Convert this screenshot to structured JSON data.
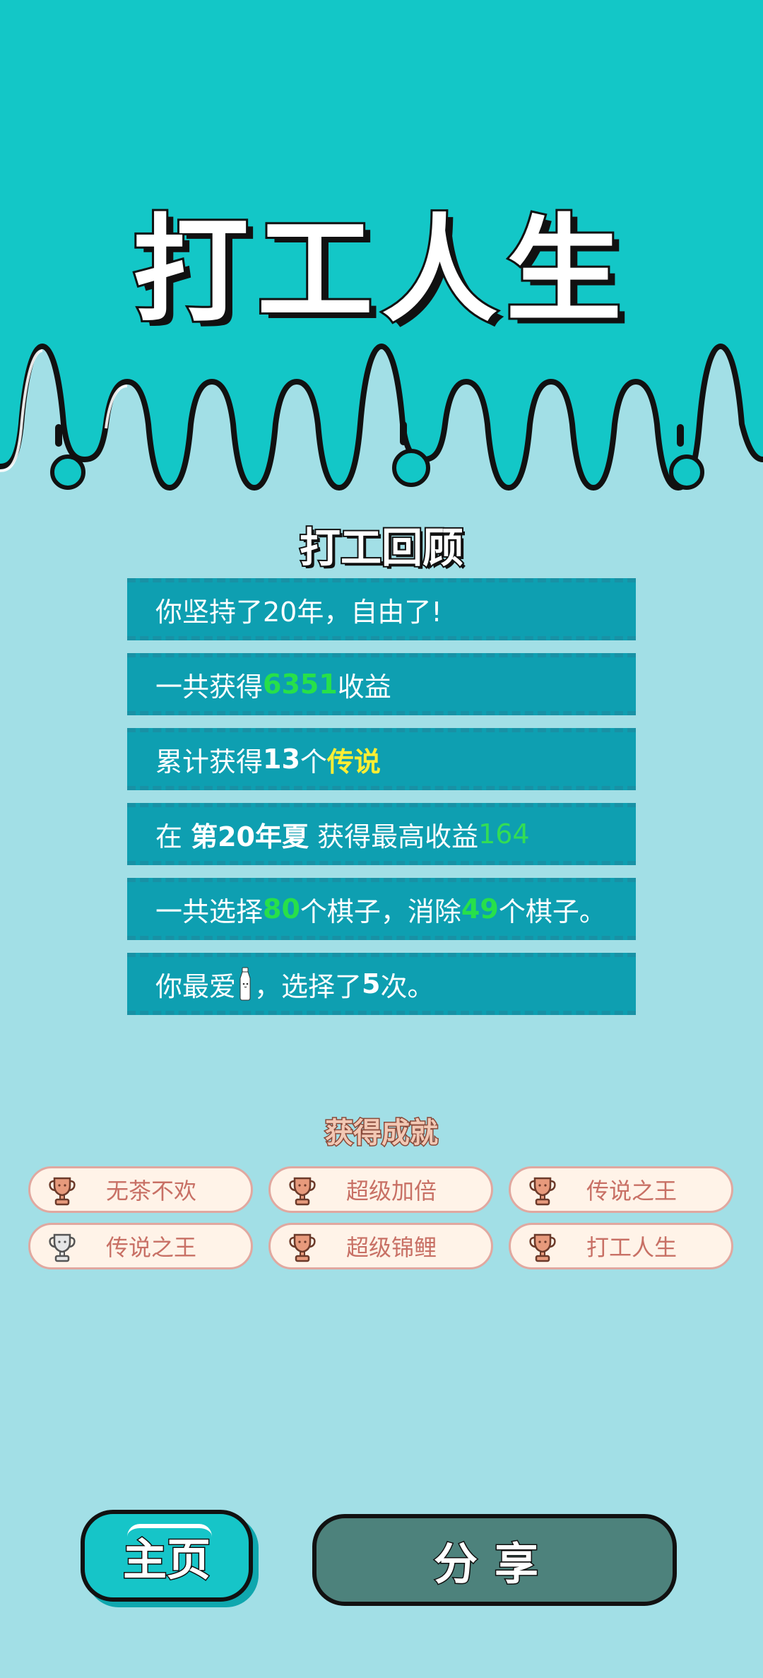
{
  "app": {
    "title": "打工人生"
  },
  "review": {
    "title": "打工回顾",
    "rows": [
      {
        "parts": [
          {
            "t": "你坚持了20年，自由了!"
          }
        ]
      },
      {
        "parts": [
          {
            "t": "一共获得"
          },
          {
            "t": "6351"
          },
          {
            "t": "收益"
          }
        ]
      },
      {
        "parts": [
          {
            "t": "累计获得"
          },
          {
            "t": "13"
          },
          {
            "t": "个"
          },
          {
            "t": "传说"
          }
        ]
      },
      {
        "parts": [
          {
            "t": "在 "
          },
          {
            "t": "第20年夏"
          },
          {
            "t": " 获得最高收益"
          },
          {
            "t": "164"
          }
        ]
      },
      {
        "parts": [
          {
            "t": "一共选择"
          },
          {
            "t": "80"
          },
          {
            "t": "个棋子，消除"
          },
          {
            "t": "49"
          },
          {
            "t": "个棋子。"
          }
        ]
      },
      {
        "parts": [
          {
            "t": "你最爱"
          },
          {
            "icon": "milk-bottle-icon"
          },
          {
            "t": "，选择了"
          },
          {
            "t": "5"
          },
          {
            "t": "次。"
          }
        ]
      }
    ]
  },
  "achievements": {
    "title": "获得成就",
    "items": [
      {
        "label": "无茶不欢",
        "icon": "trophy-icon",
        "tier": "bronze"
      },
      {
        "label": "超级加倍",
        "icon": "trophy-icon",
        "tier": "bronze"
      },
      {
        "label": "传说之王",
        "icon": "trophy-icon",
        "tier": "bronze"
      },
      {
        "label": "传说之王",
        "icon": "trophy-icon",
        "tier": "silver"
      },
      {
        "label": "超级锦鲤",
        "icon": "trophy-icon",
        "tier": "bronze"
      },
      {
        "label": "打工人生",
        "icon": "trophy-icon",
        "tier": "bronze"
      }
    ]
  },
  "buttons": {
    "home": "主页",
    "share": "分享"
  },
  "colors": {
    "header_bg": "#13c7c7",
    "body_bg": "#a2dfe6",
    "row_bg": "#0e9fb1",
    "highlight_green": "#27e04a",
    "highlight_yellow": "#ffee33",
    "share_button": "#4d827c",
    "home_button": "#16c5c8"
  }
}
